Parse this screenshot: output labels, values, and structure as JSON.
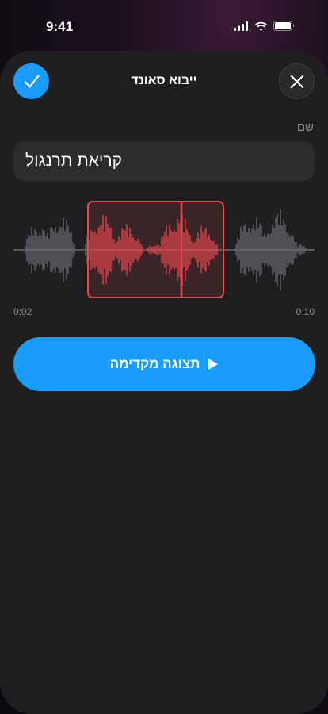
{
  "status_bar": {
    "time": "9:41"
  },
  "sheet": {
    "title": "ייבוא סאונד",
    "confirm_icon": "checkmark-icon",
    "close_icon": "close-icon"
  },
  "name_field": {
    "label": "שם",
    "value": "קריאת תרנגול"
  },
  "trimmer": {
    "start_time": "0:02",
    "end_time": "0:10"
  },
  "preview_button": {
    "label": "תצוגה מקדימה",
    "icon": "play-icon"
  },
  "colors": {
    "accent": "#1a9cff",
    "selection": "#e5484d",
    "waveform_inactive": "#6b6b6f",
    "sheet_bg": "#1f1f21"
  }
}
